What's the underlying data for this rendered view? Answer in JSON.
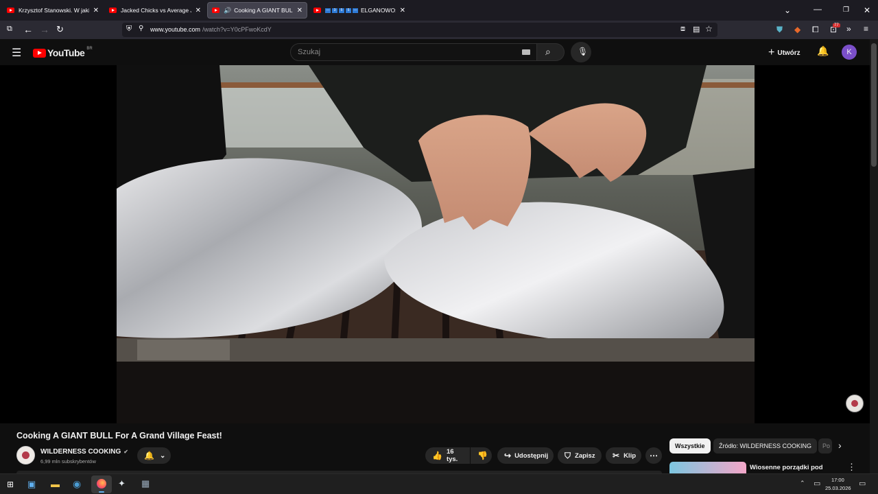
{
  "browser": {
    "tabs": [
      {
        "title": "Krzysztof Stanowski. W jakiej sp",
        "active": false
      },
      {
        "title": "Jacked Chicks vs Average Joes |",
        "active": false
      },
      {
        "title": "Cooking A GIANT BULL For",
        "active": true,
        "playing": true
      },
      {
        "title": "ELGANOWO: D",
        "active": false,
        "badges": [
          "3",
          "5",
          "5"
        ]
      }
    ],
    "url_host": "www.youtube.com",
    "url_path": "/watch?v=Y0cPFwoKcdY",
    "extension_badge": "77"
  },
  "youtube": {
    "logo_text": "YouTube",
    "region": "BR",
    "search_placeholder": "Szukaj",
    "create_label": "Utwórz",
    "avatar_letter": "K",
    "accent": "#ff0000",
    "avatar_color": "#7b4fc9"
  },
  "video": {
    "title": "Cooking A GIANT BULL For A Grand Village Feast!",
    "channel_name": "WILDERNESS COOKING",
    "subscribers": "6,99 mln subskrybentów",
    "watermark": "WILDERNESS COOKING",
    "likes": "16 tys.",
    "share_label": "Udostępnij",
    "save_label": "Zapisz",
    "clip_label": "Klip"
  },
  "sidebar": {
    "chips": [
      "Wszystkie",
      "Źródło: WILDERNESS COOKING",
      "Po"
    ],
    "next_video_title": "Wiosenne porządki pod komenda"
  },
  "taskbar": {
    "time": "17:00",
    "date": "25.03.2026"
  }
}
